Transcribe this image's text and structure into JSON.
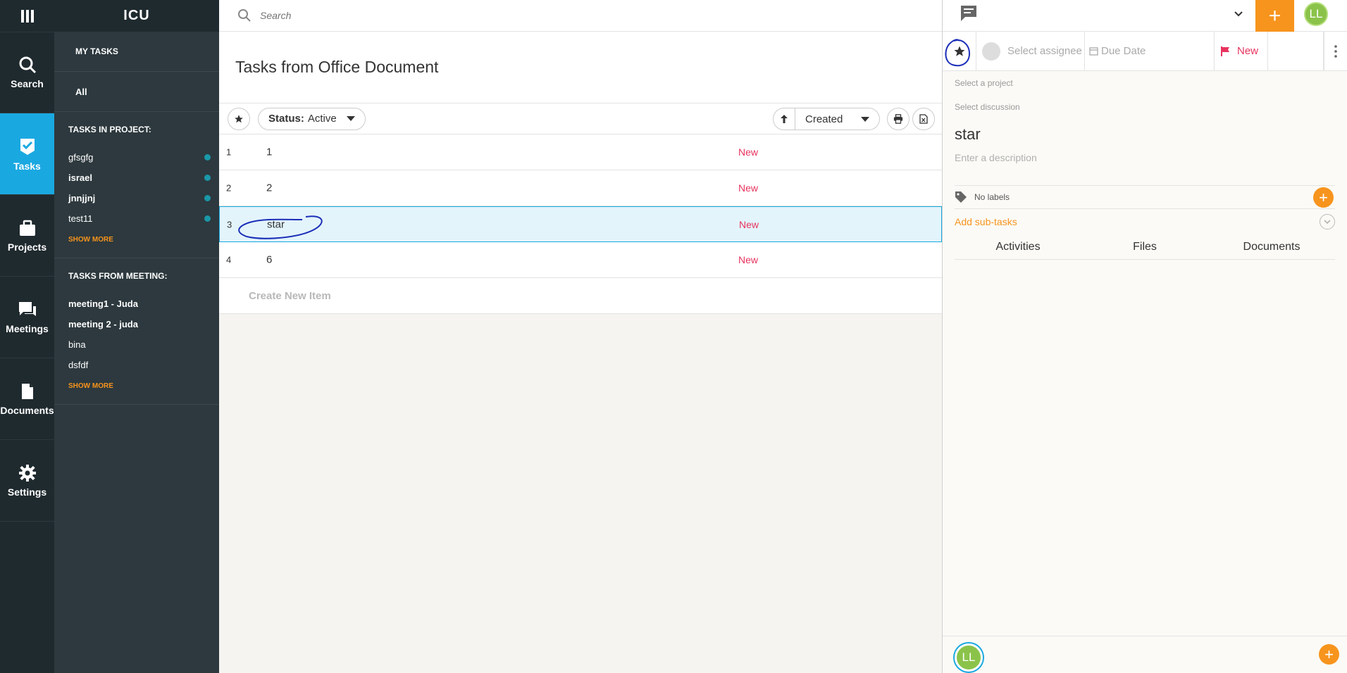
{
  "app": {
    "brand": "ICU"
  },
  "rail": {
    "items": [
      {
        "label": "Search",
        "icon": "search-icon"
      },
      {
        "label": "Tasks",
        "icon": "check-icon",
        "active": true
      },
      {
        "label": "Projects",
        "icon": "briefcase-icon"
      },
      {
        "label": "Meetings",
        "icon": "chat-bubbles-icon"
      },
      {
        "label": "Documents",
        "icon": "document-icon"
      },
      {
        "label": "Settings",
        "icon": "gear-icon"
      }
    ]
  },
  "nav": {
    "my_tasks": "MY TASKS",
    "all": "All",
    "projects_heading": "TASKS IN PROJECT:",
    "projects": [
      {
        "label": "gfsgfg",
        "bold": false
      },
      {
        "label": "israel",
        "bold": true
      },
      {
        "label": "jnnjjnj",
        "bold": true
      },
      {
        "label": "test11",
        "bold": false
      }
    ],
    "show_more_projects": "SHOW MORE",
    "meetings_heading": "TASKS FROM MEETING:",
    "meetings": [
      {
        "label": "meeting1 - Juda",
        "bold": true
      },
      {
        "label": "meeting 2 - juda",
        "bold": true
      },
      {
        "label": "bina",
        "bold": false
      },
      {
        "label": "dsfdf",
        "bold": false
      }
    ],
    "show_more_meetings": "SHOW MORE",
    "dot_color": "#1a98a8"
  },
  "main": {
    "search_placeholder": "Search",
    "page_title": "Tasks from Office Document",
    "filter": {
      "status_key": "Status:",
      "status_value": "Active"
    },
    "sort": {
      "value": "Created"
    },
    "tasks": [
      {
        "num": "1",
        "name": "1",
        "status": "New"
      },
      {
        "num": "2",
        "name": "2",
        "status": "New"
      },
      {
        "num": "3",
        "name": "star",
        "status": "New",
        "selected": true
      },
      {
        "num": "4",
        "name": "6",
        "status": "New"
      }
    ],
    "create_new": "Create New Item"
  },
  "detail": {
    "avatar_initials": "LL",
    "assignee_placeholder": "Select assignee",
    "due_date_placeholder": "Due Date",
    "status": "New",
    "project_placeholder": "Select a project",
    "discussion_placeholder": "Select discussion",
    "title": "star",
    "description_placeholder": "Enter a description",
    "labels": "No labels",
    "add_subtasks": "Add sub-tasks",
    "tabs": [
      "Activities",
      "Files",
      "Documents"
    ]
  },
  "colors": {
    "accent_blue": "#1aa8e1",
    "accent_orange": "#f7941d",
    "status_new": "#e8335e",
    "rail_bg": "#1f2a2f",
    "nav_bg": "#2d393e",
    "annotation_ink": "#1c2fb8"
  }
}
